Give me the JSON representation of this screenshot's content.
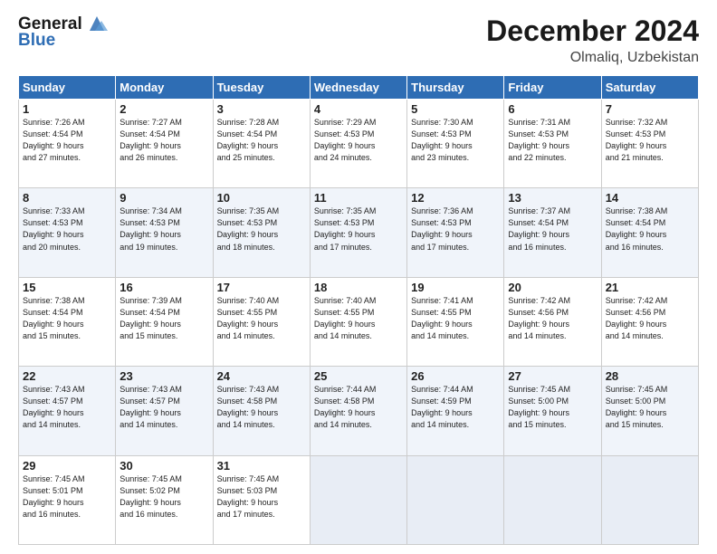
{
  "header": {
    "logo_line1": "General",
    "logo_line2": "Blue",
    "month": "December 2024",
    "location": "Olmaliq, Uzbekistan"
  },
  "days_of_week": [
    "Sunday",
    "Monday",
    "Tuesday",
    "Wednesday",
    "Thursday",
    "Friday",
    "Saturday"
  ],
  "weeks": [
    [
      {
        "day": 1,
        "info": "Sunrise: 7:26 AM\nSunset: 4:54 PM\nDaylight: 9 hours\nand 27 minutes."
      },
      {
        "day": 2,
        "info": "Sunrise: 7:27 AM\nSunset: 4:54 PM\nDaylight: 9 hours\nand 26 minutes."
      },
      {
        "day": 3,
        "info": "Sunrise: 7:28 AM\nSunset: 4:54 PM\nDaylight: 9 hours\nand 25 minutes."
      },
      {
        "day": 4,
        "info": "Sunrise: 7:29 AM\nSunset: 4:53 PM\nDaylight: 9 hours\nand 24 minutes."
      },
      {
        "day": 5,
        "info": "Sunrise: 7:30 AM\nSunset: 4:53 PM\nDaylight: 9 hours\nand 23 minutes."
      },
      {
        "day": 6,
        "info": "Sunrise: 7:31 AM\nSunset: 4:53 PM\nDaylight: 9 hours\nand 22 minutes."
      },
      {
        "day": 7,
        "info": "Sunrise: 7:32 AM\nSunset: 4:53 PM\nDaylight: 9 hours\nand 21 minutes."
      }
    ],
    [
      {
        "day": 8,
        "info": "Sunrise: 7:33 AM\nSunset: 4:53 PM\nDaylight: 9 hours\nand 20 minutes."
      },
      {
        "day": 9,
        "info": "Sunrise: 7:34 AM\nSunset: 4:53 PM\nDaylight: 9 hours\nand 19 minutes."
      },
      {
        "day": 10,
        "info": "Sunrise: 7:35 AM\nSunset: 4:53 PM\nDaylight: 9 hours\nand 18 minutes."
      },
      {
        "day": 11,
        "info": "Sunrise: 7:35 AM\nSunset: 4:53 PM\nDaylight: 9 hours\nand 17 minutes."
      },
      {
        "day": 12,
        "info": "Sunrise: 7:36 AM\nSunset: 4:53 PM\nDaylight: 9 hours\nand 17 minutes."
      },
      {
        "day": 13,
        "info": "Sunrise: 7:37 AM\nSunset: 4:54 PM\nDaylight: 9 hours\nand 16 minutes."
      },
      {
        "day": 14,
        "info": "Sunrise: 7:38 AM\nSunset: 4:54 PM\nDaylight: 9 hours\nand 16 minutes."
      }
    ],
    [
      {
        "day": 15,
        "info": "Sunrise: 7:38 AM\nSunset: 4:54 PM\nDaylight: 9 hours\nand 15 minutes."
      },
      {
        "day": 16,
        "info": "Sunrise: 7:39 AM\nSunset: 4:54 PM\nDaylight: 9 hours\nand 15 minutes."
      },
      {
        "day": 17,
        "info": "Sunrise: 7:40 AM\nSunset: 4:55 PM\nDaylight: 9 hours\nand 14 minutes."
      },
      {
        "day": 18,
        "info": "Sunrise: 7:40 AM\nSunset: 4:55 PM\nDaylight: 9 hours\nand 14 minutes."
      },
      {
        "day": 19,
        "info": "Sunrise: 7:41 AM\nSunset: 4:55 PM\nDaylight: 9 hours\nand 14 minutes."
      },
      {
        "day": 20,
        "info": "Sunrise: 7:42 AM\nSunset: 4:56 PM\nDaylight: 9 hours\nand 14 minutes."
      },
      {
        "day": 21,
        "info": "Sunrise: 7:42 AM\nSunset: 4:56 PM\nDaylight: 9 hours\nand 14 minutes."
      }
    ],
    [
      {
        "day": 22,
        "info": "Sunrise: 7:43 AM\nSunset: 4:57 PM\nDaylight: 9 hours\nand 14 minutes."
      },
      {
        "day": 23,
        "info": "Sunrise: 7:43 AM\nSunset: 4:57 PM\nDaylight: 9 hours\nand 14 minutes."
      },
      {
        "day": 24,
        "info": "Sunrise: 7:43 AM\nSunset: 4:58 PM\nDaylight: 9 hours\nand 14 minutes."
      },
      {
        "day": 25,
        "info": "Sunrise: 7:44 AM\nSunset: 4:58 PM\nDaylight: 9 hours\nand 14 minutes."
      },
      {
        "day": 26,
        "info": "Sunrise: 7:44 AM\nSunset: 4:59 PM\nDaylight: 9 hours\nand 14 minutes."
      },
      {
        "day": 27,
        "info": "Sunrise: 7:45 AM\nSunset: 5:00 PM\nDaylight: 9 hours\nand 15 minutes."
      },
      {
        "day": 28,
        "info": "Sunrise: 7:45 AM\nSunset: 5:00 PM\nDaylight: 9 hours\nand 15 minutes."
      }
    ],
    [
      {
        "day": 29,
        "info": "Sunrise: 7:45 AM\nSunset: 5:01 PM\nDaylight: 9 hours\nand 16 minutes."
      },
      {
        "day": 30,
        "info": "Sunrise: 7:45 AM\nSunset: 5:02 PM\nDaylight: 9 hours\nand 16 minutes."
      },
      {
        "day": 31,
        "info": "Sunrise: 7:45 AM\nSunset: 5:03 PM\nDaylight: 9 hours\nand 17 minutes."
      },
      null,
      null,
      null,
      null
    ]
  ]
}
